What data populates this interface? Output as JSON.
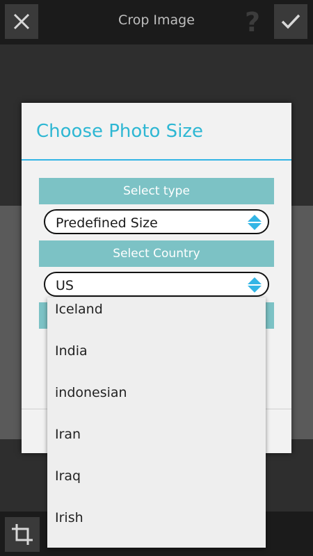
{
  "topbar": {
    "title": "Crop Image",
    "help_label": "?"
  },
  "dialog": {
    "title": "Choose Photo Size",
    "select_type_label": "Select type",
    "type_value": "Predefined Size",
    "select_country_label": "Select Country",
    "country_value": "US"
  },
  "dropdown": {
    "items": [
      "Iceland",
      "India",
      "indonesian",
      "Iran",
      "Iraq",
      "Irish"
    ]
  },
  "colors": {
    "accent": "#2eb7d3",
    "band": "#7cc2c5",
    "arrows": "#33b5e5"
  }
}
